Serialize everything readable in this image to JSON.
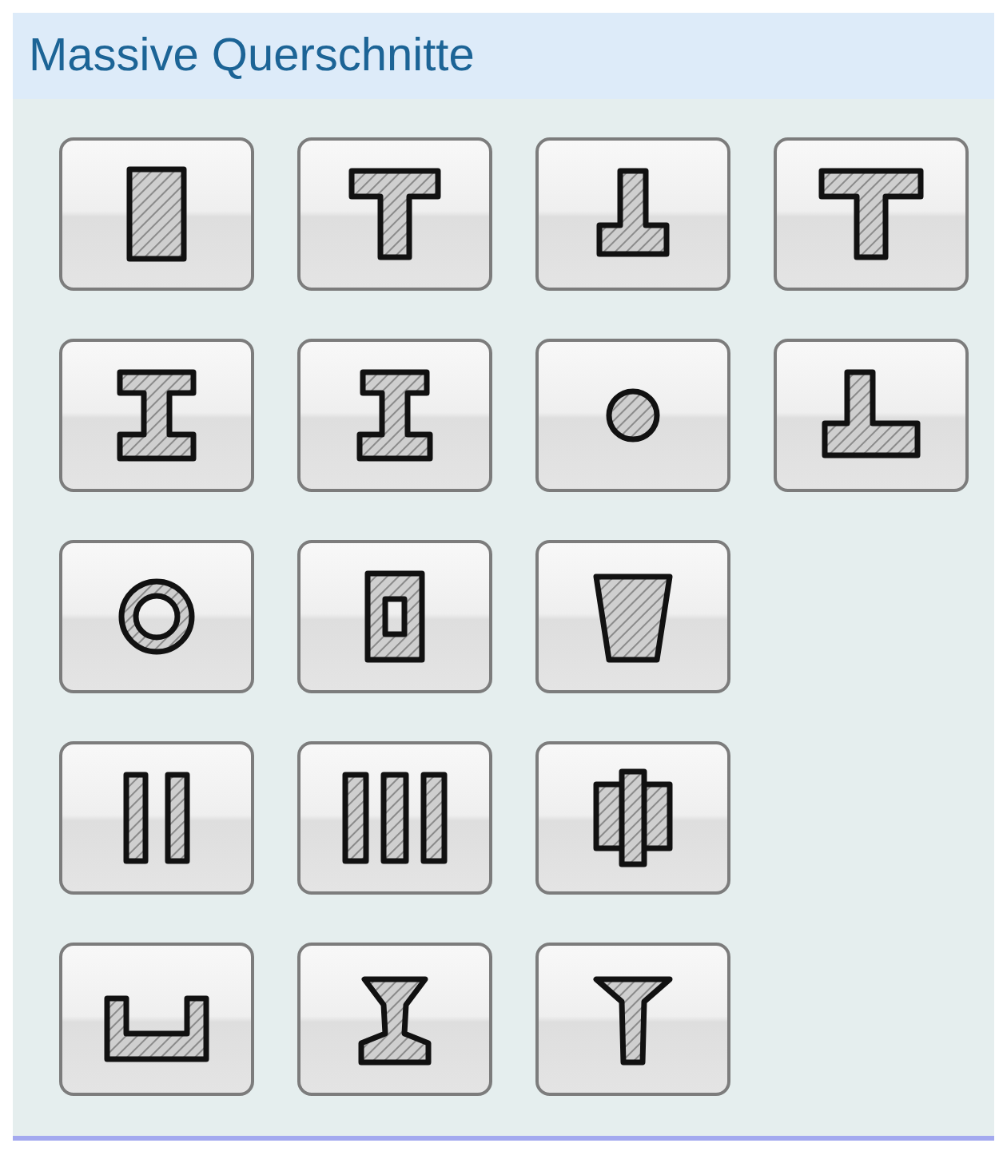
{
  "panel": {
    "title": "Massive Querschnitte"
  },
  "rows": [
    [
      {
        "kind": "rectangle"
      },
      {
        "kind": "tee"
      },
      {
        "kind": "inverted-tee"
      },
      {
        "kind": "wide-tee"
      }
    ],
    [
      {
        "kind": "i-beam"
      },
      {
        "kind": "i-beam-narrow"
      },
      {
        "kind": "circle"
      },
      {
        "kind": "wide-inverted-tee"
      }
    ],
    [
      {
        "kind": "ring"
      },
      {
        "kind": "hollow-rectangle"
      },
      {
        "kind": "trapezoid"
      }
    ],
    [
      {
        "kind": "two-bars"
      },
      {
        "kind": "three-bars"
      },
      {
        "kind": "stacked-blocks"
      }
    ],
    [
      {
        "kind": "channel"
      },
      {
        "kind": "tapered-i-beam"
      },
      {
        "kind": "tapered-tee"
      }
    ]
  ]
}
